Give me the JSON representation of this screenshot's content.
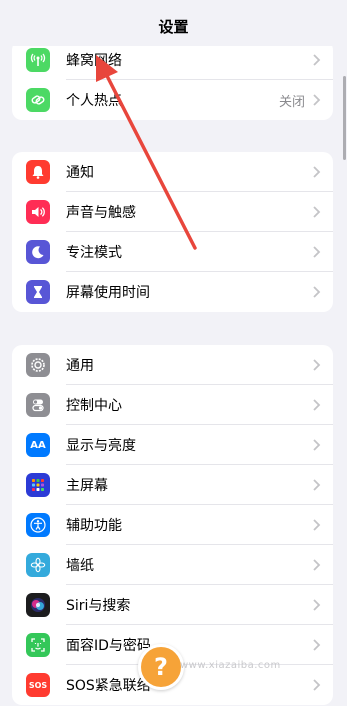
{
  "header": {
    "title": "设置"
  },
  "group1": {
    "items": [
      {
        "label": "蜂窝网络",
        "value": "",
        "icon": "cellular-antenna-icon",
        "color": "#4cd964"
      },
      {
        "label": "个人热点",
        "value": "关闭",
        "icon": "personal-hotspot-chain-icon",
        "color": "#4cd964"
      }
    ]
  },
  "group2": {
    "items": [
      {
        "label": "通知",
        "icon": "notification-bell-icon",
        "color": "#ff3b30"
      },
      {
        "label": "声音与触感",
        "icon": "speaker-icon",
        "color": "#ff2d55"
      },
      {
        "label": "专注模式",
        "icon": "moon-icon",
        "color": "#5856d6"
      },
      {
        "label": "屏幕使用时间",
        "icon": "hourglass-icon",
        "color": "#5856d6"
      }
    ]
  },
  "group3": {
    "items": [
      {
        "label": "通用",
        "icon": "gear-icon",
        "color": "#8e8e93"
      },
      {
        "label": "控制中心",
        "icon": "toggle-switches-icon",
        "color": "#8e8e93"
      },
      {
        "label": "显示与亮度",
        "icon": "text-size-aa-icon",
        "color": "#007aff"
      },
      {
        "label": "主屏幕",
        "icon": "home-screen-grid-icon",
        "color": "#2c3bd6"
      },
      {
        "label": "辅助功能",
        "icon": "accessibility-person-icon",
        "color": "#007aff"
      },
      {
        "label": "墙纸",
        "icon": "wallpaper-flower-icon",
        "color": "#34aadc"
      },
      {
        "label": "Siri与搜索",
        "icon": "siri-orb-icon",
        "color": "#1c1c1e"
      },
      {
        "label": "面容ID与密码",
        "icon": "face-id-icon",
        "color": "#34c759"
      },
      {
        "label": "SOS紧急联络",
        "icon": "sos-icon",
        "color": "#ff3b30"
      }
    ]
  },
  "icon_text": {
    "aa": "AA",
    "sos": "SOS"
  },
  "overlay": {
    "help_symbol": "?",
    "watermark": "www.xiazaiba.com"
  },
  "colors": {
    "background": "#f2f2f7",
    "annotation_arrow": "#e8463c",
    "help_badge": "#f6a338"
  }
}
